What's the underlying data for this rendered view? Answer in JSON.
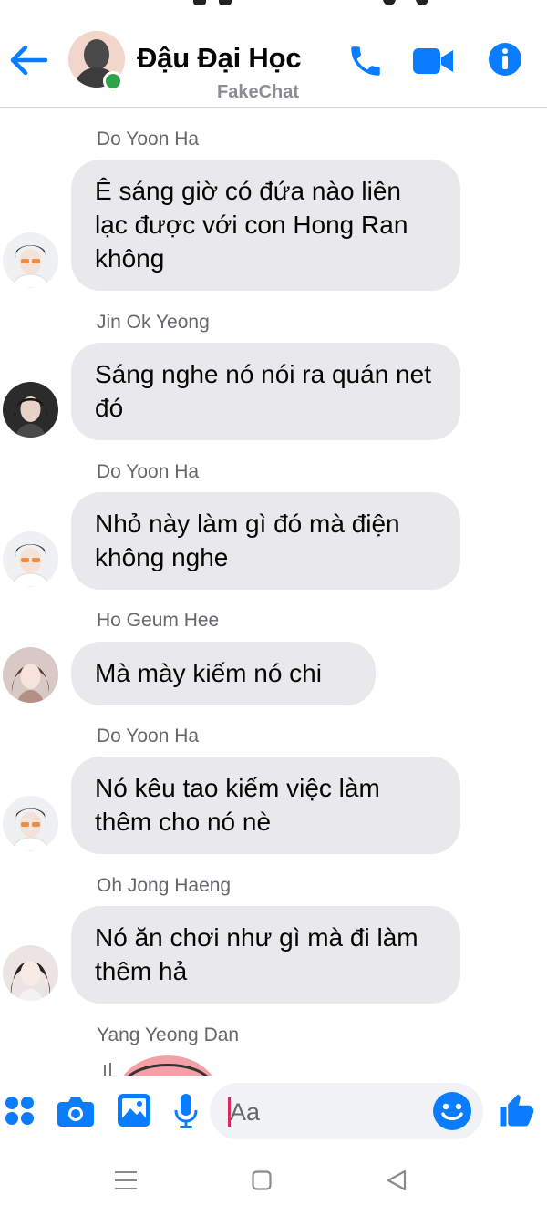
{
  "header": {
    "title": "Đậu Đại Học",
    "subtitle": "FakeChat",
    "accent": "#0a7cff",
    "online_color": "#31a24c",
    "icons": [
      "back-arrow-icon",
      "phone-icon",
      "video-camera-icon",
      "info-icon"
    ]
  },
  "messages": [
    {
      "sender": "Do Yoon Ha",
      "text": "Ê sáng giờ có đứa nào liên lạc được với con Hong Ran không"
    },
    {
      "sender": "Jin Ok Yeong",
      "text": "Sáng nghe nó nói ra quán net đó"
    },
    {
      "sender": "Do Yoon Ha",
      "text": "Nhỏ này làm gì đó mà điện không nghe"
    },
    {
      "sender": "Ho Geum Hee",
      "text": "Mà mày kiếm nó chi"
    },
    {
      "sender": "Do Yoon Ha",
      "text": "Nó kêu tao kiếm việc làm thêm cho nó nè"
    },
    {
      "sender": "Oh Jong Haeng",
      "text": "Nó ăn chơi như gì mà đi làm thêm hả"
    },
    {
      "sender": "Yang Yeong Dan",
      "text": ""
    }
  ],
  "composer": {
    "placeholder": "Aa",
    "icons": [
      "apps-grid-icon",
      "camera-icon",
      "gallery-icon",
      "microphone-icon",
      "emoji-icon",
      "thumbs-up-icon"
    ]
  },
  "navbar": {
    "icons": [
      "menu-icon",
      "home-icon",
      "back-icon"
    ]
  },
  "colors": {
    "bubble_bg": "#e9e9ec",
    "sender_text": "#65676b",
    "divider": "#d8d8d8"
  }
}
